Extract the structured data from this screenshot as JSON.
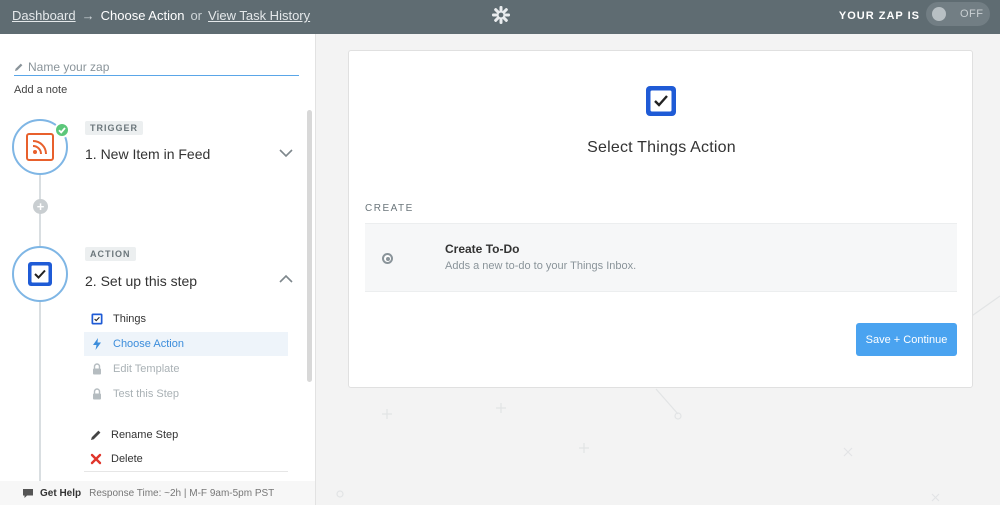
{
  "topbar": {
    "crumbs": {
      "dashboard": "Dashboard",
      "arrow": "→",
      "current": "Choose Action",
      "or": "or",
      "history": "View Task History"
    },
    "zap_status_label": "YOUR ZAP IS",
    "toggle_label": "OFF",
    "logo_icon": "zapier-asterisk-icon"
  },
  "sidebar": {
    "name_placeholder": "Name your zap",
    "add_note": "Add a note",
    "steps": [
      {
        "tag": "TRIGGER",
        "title": "1. New Item in Feed",
        "icon": "rss-icon",
        "status": "complete"
      },
      {
        "tag": "ACTION",
        "title": "2. Set up this step",
        "icon": "checkbox-icon",
        "status": "active"
      }
    ],
    "substeps": [
      {
        "label": "Things",
        "icon": "checkbox-icon",
        "state": "normal"
      },
      {
        "label": "Choose Action",
        "icon": "bolt-icon",
        "state": "active"
      },
      {
        "label": "Edit Template",
        "icon": "lock-icon",
        "state": "disabled"
      },
      {
        "label": "Test this Step",
        "icon": "lock-icon",
        "state": "disabled"
      }
    ],
    "actions": {
      "rename": "Rename Step",
      "delete": "Delete"
    },
    "help": {
      "label": "Get Help",
      "text": "Response Time: ~2h | M-F 9am-5pm PST"
    }
  },
  "main": {
    "title": "Select Things Action",
    "section": "CREATE",
    "option": {
      "title": "Create To-Do",
      "description": "Adds a new to-do to your Things Inbox."
    },
    "save_button": "Save + Continue"
  },
  "colors": {
    "topbar": "#5f6c72",
    "accent": "#4aa3f0",
    "success": "#5cc77a",
    "rss": "#e8602c",
    "things": "#1f5bd6",
    "delete": "#e0352b"
  }
}
